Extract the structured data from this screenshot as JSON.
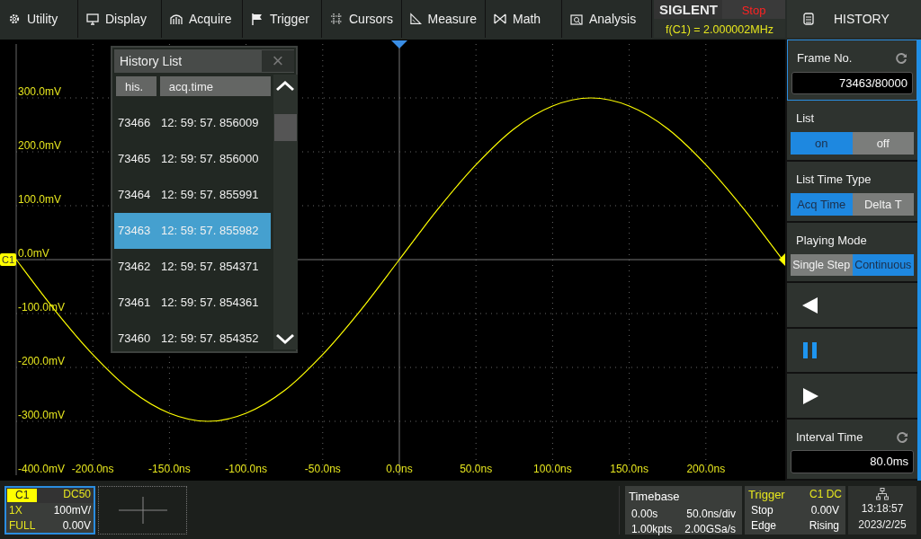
{
  "menu": [
    {
      "label": "Utility"
    },
    {
      "label": "Display"
    },
    {
      "label": "Acquire"
    },
    {
      "label": "Trigger"
    },
    {
      "label": "Cursors"
    },
    {
      "label": "Measure"
    },
    {
      "label": "Math"
    },
    {
      "label": "Analysis"
    }
  ],
  "status": {
    "brand": "SIGLENT",
    "run_state": "Stop",
    "frequency": "f(C1) = 2.000002MHz"
  },
  "waveform": {
    "chart_data": {
      "type": "line",
      "grid": true,
      "x": [
        -250,
        -225,
        -200,
        -175,
        -150,
        -125,
        -100,
        -75,
        -50,
        -25,
        0,
        25,
        50,
        75,
        100,
        125,
        150,
        175,
        200,
        225,
        250
      ],
      "series": [
        {
          "name": "C1",
          "color": "#ffff00",
          "values": [
            0,
            -93,
            -176,
            -243,
            -285,
            -300,
            -285,
            -243,
            -176,
            -93,
            0,
            93,
            176,
            243,
            285,
            300,
            285,
            243,
            176,
            93,
            0
          ]
        }
      ],
      "xlim": [
        -250,
        250
      ],
      "ylim": [
        -400,
        400
      ],
      "xticks": [
        {
          "value": -200,
          "label": "-200.0ns"
        },
        {
          "value": -150,
          "label": "-150.0ns"
        },
        {
          "value": -100,
          "label": "-100.0ns"
        },
        {
          "value": -50,
          "label": "-50.0ns"
        },
        {
          "value": 0,
          "label": "0.0ns"
        },
        {
          "value": 50,
          "label": "50.0ns"
        },
        {
          "value": 100,
          "label": "100.0ns"
        },
        {
          "value": 150,
          "label": "150.0ns"
        },
        {
          "value": 200,
          "label": "200.0ns"
        }
      ],
      "yticks": [
        {
          "value": 300,
          "label": "300.0mV"
        },
        {
          "value": 200,
          "label": "200.0mV"
        },
        {
          "value": 100,
          "label": "100.0mV"
        },
        {
          "value": 0,
          "label": "0.0mV"
        },
        {
          "value": -100,
          "label": "-100.0mV"
        },
        {
          "value": -200,
          "label": "-200.0mV"
        },
        {
          "value": -300,
          "label": "-300.0mV"
        },
        {
          "value": -400,
          "label": "-400.0mV"
        }
      ]
    }
  },
  "history_list": {
    "title": "History List",
    "close": "×",
    "columns": [
      "his.",
      "acq.time"
    ],
    "rows": [
      {
        "his": "73466",
        "acq_time": "12: 59: 57. 856009",
        "selected": false
      },
      {
        "his": "73465",
        "acq_time": "12: 59: 57. 856000",
        "selected": false
      },
      {
        "his": "73464",
        "acq_time": "12: 59: 57. 855991",
        "selected": false
      },
      {
        "his": "73463",
        "acq_time": "12: 59: 57. 855982",
        "selected": true
      },
      {
        "his": "73462",
        "acq_time": "12: 59: 57. 854371",
        "selected": false
      },
      {
        "his": "73461",
        "acq_time": "12: 59: 57. 854361",
        "selected": false
      },
      {
        "his": "73460",
        "acq_time": "12: 59: 57. 854352",
        "selected": false
      }
    ]
  },
  "history_panel": {
    "title": "HISTORY",
    "frame_no": {
      "label": "Frame No.",
      "value": "73463/80000"
    },
    "toggles": [
      {
        "label": "List",
        "options": [
          {
            "label": "on",
            "selected": true
          },
          {
            "label": "off",
            "selected": false
          }
        ]
      },
      {
        "label": "List Time Type",
        "options": [
          {
            "label": "Acq Time",
            "selected": true
          },
          {
            "label": "Delta T",
            "selected": false
          }
        ]
      },
      {
        "label": "Playing Mode",
        "options": [
          {
            "label": "Single Step",
            "selected": false
          },
          {
            "label": "Continuous",
            "selected": true
          }
        ]
      }
    ],
    "playback": [
      {
        "kind": "back",
        "active": false
      },
      {
        "kind": "pause",
        "active": true
      },
      {
        "kind": "play",
        "active": false
      }
    ],
    "interval_time": {
      "label": "Interval Time",
      "value": "80.0ms"
    }
  },
  "channel": {
    "name": "C1",
    "coupling": "DC50",
    "probe": "1X",
    "scale": "100mV/",
    "bandwidth": "FULL",
    "offset": "0.00V"
  },
  "timebase": {
    "title": "Timebase",
    "delay": "0.00s",
    "scale": "50.0ns/div",
    "memory": "1.00kpts",
    "sample_rate": "2.00GSa/s"
  },
  "trigger": {
    "title": "Trigger",
    "source": "C1 DC",
    "state": "Stop",
    "level": "0.00V",
    "type": "Edge",
    "slope": "Rising"
  },
  "clock": {
    "time": "13:18:57",
    "date": "2023/2/25"
  }
}
